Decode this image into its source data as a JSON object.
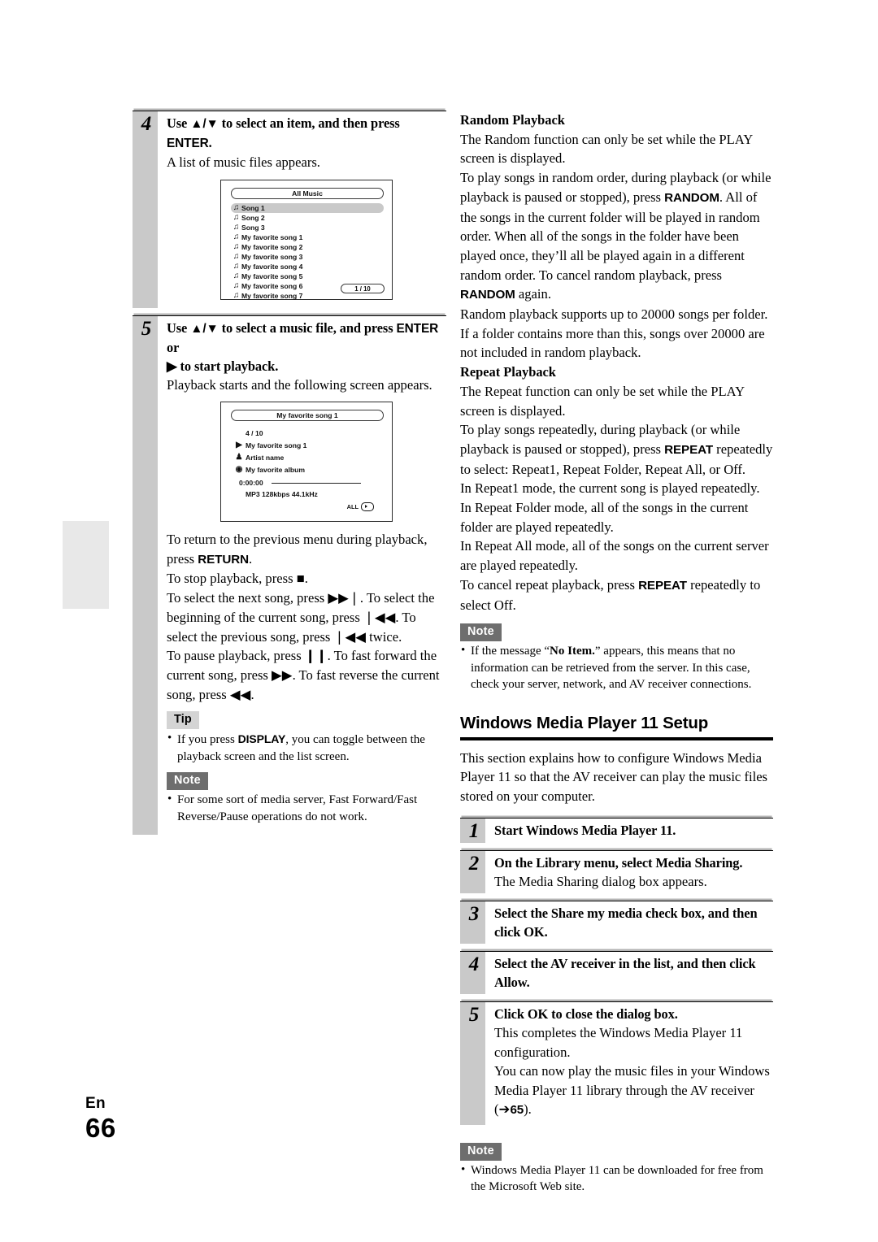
{
  "footer": {
    "lang": "En",
    "page": "66"
  },
  "left_column": {
    "step4": {
      "number": "4",
      "title_pre": "Use ",
      "title_arrows": "▲/▼",
      "title_mid": " to select an item, and then press ",
      "title_key": "ENTER",
      "title_end": ".",
      "body": "A list of music files appears.",
      "screen": {
        "title": "All Music",
        "items": [
          "Song 1",
          "Song 2",
          "Song 3",
          "My favorite song 1",
          "My favorite song 2",
          "My favorite song 3",
          "My favorite song 4",
          "My favorite song 5",
          "My favorite song 6",
          "My favorite song 7"
        ],
        "selected_index": 0,
        "page_indicator": "1 / 10",
        "note_icon": "♫"
      }
    },
    "step5": {
      "number": "5",
      "title_pre": "Use ",
      "title_arrows": "▲/▼",
      "title_mid": " to select a music file, and press ",
      "title_key": "ENTER",
      "title_or": " or",
      "title_line2_icon": "▶",
      "title_line2": " to start playback.",
      "body": "Playback starts and the following screen appears.",
      "screen": {
        "title": "My favorite song 1",
        "track_position": "4 / 10",
        "song": "My favorite song 1",
        "artist": "Artist name",
        "album": "My favorite album",
        "time": "0:00:00",
        "format": "MP3 128kbps 44.1kHz",
        "repeat_label": "ALL"
      }
    },
    "paragraphs": [
      {
        "pre": "To return to the previous menu during playback, press ",
        "key": "RETURN",
        "post": "."
      },
      {
        "pre": "To stop playback, press ",
        "sym": "■",
        "post": "."
      }
    ],
    "transport_para1_a": "To select the next song, press ",
    "transport_sym_next": "▶▶❘",
    "transport_para1_b": ". To select the beginning of the current song, press ",
    "transport_sym_prev": "❘◀◀",
    "transport_para1_c": ". To select the previous song, press ",
    "transport_sym_prev2": "❘◀◀",
    "transport_para1_d": " twice.",
    "transport_para2_a": "To pause playback, press ",
    "transport_sym_pause": "❙❙",
    "transport_para2_b": ". To fast forward the current song, press ",
    "transport_sym_ff": "▶▶",
    "transport_para2_c": ". To fast reverse the current song, press ",
    "transport_sym_fr": "◀◀",
    "transport_para2_d": ".",
    "tip": {
      "label": "Tip",
      "item_pre": "If you press ",
      "item_key": "DISPLAY",
      "item_post": ", you can toggle between the playback screen and the list screen."
    },
    "note": {
      "label": "Note",
      "item": "For some sort of media server, Fast Forward/Fast Reverse/Pause operations do not work."
    }
  },
  "right_column": {
    "random": {
      "heading": "Random Playback",
      "p1": "The Random function can only be set while the PLAY screen is displayed.",
      "p2_a": "To play songs in random order, during playback (or while playback is paused or stopped), press ",
      "p2_key1": "RANDOM",
      "p2_b": ". All of the songs in the current folder will be played in random order. When all of the songs in the folder have been played once, they’ll all be played again in a different random order. To cancel random playback, press ",
      "p2_key2": "RANDOM",
      "p2_c": " again.",
      "p3": "Random playback supports up to 20000 songs per folder. If a folder contains more than this, songs over 20000 are not included in random playback."
    },
    "repeat": {
      "heading": "Repeat Playback",
      "p1": "The Repeat function can only be set while the PLAY screen is displayed.",
      "p2_a": "To play songs repeatedly, during playback (or while playback is paused or stopped), press ",
      "p2_key": "REPEAT",
      "p2_b": " repeatedly to select: Repeat1, Repeat Folder, Repeat All, or Off.",
      "p3": "In Repeat1 mode, the current song is played repeatedly.",
      "p4": "In Repeat Folder mode, all of the songs in the current folder are played repeatedly.",
      "p5": "In Repeat All mode, all of the songs on the current server are played repeatedly.",
      "p6_a": "To cancel repeat playback, press ",
      "p6_key": "REPEAT",
      "p6_b": " repeatedly to select Off."
    },
    "note1": {
      "label": "Note",
      "item_a": "If the message “",
      "item_bold": "No Item.",
      "item_b": "” appears, this means that no information can be retrieved from the server. In this case, check your server, network, and AV receiver connections."
    },
    "wmp_section": {
      "heading": "Windows Media Player 11 Setup",
      "intro": "This section explains how to configure Windows Media Player 11 so that the AV receiver can play the music files stored on your computer.",
      "steps": [
        {
          "number": "1",
          "title": "Start Windows Media Player 11.",
          "body": ""
        },
        {
          "number": "2",
          "title": "On the Library menu, select Media Sharing.",
          "body": "The Media Sharing dialog box appears."
        },
        {
          "number": "3",
          "title": "Select the Share my media check box, and then click OK.",
          "body": ""
        },
        {
          "number": "4",
          "title": "Select the AV receiver in the list, and then click Allow.",
          "body": ""
        },
        {
          "number": "5",
          "title": "Click OK to close the dialog box.",
          "body": ""
        }
      ],
      "step5_body1": "This completes the Windows Media Player 11 configuration.",
      "step5_body2": "You can now play the music files in your Windows Media Player 11 library through the AV receiver",
      "step5_ref_open": "(",
      "step5_ref_arrow": "➔",
      "step5_ref_page": "65",
      "step5_ref_close": ")."
    },
    "note2": {
      "label": "Note",
      "item": "Windows Media Player 11 can be downloaded for free from the Microsoft Web site."
    }
  }
}
